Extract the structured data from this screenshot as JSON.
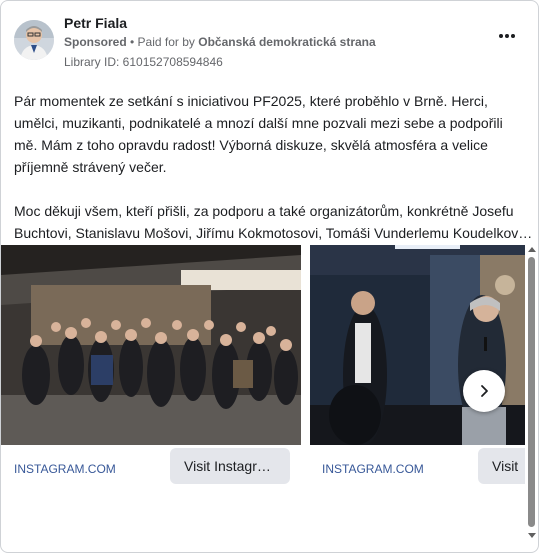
{
  "post": {
    "page_name": "Petr Fiala",
    "sponsored_label": "Sponsored",
    "separator": " • ",
    "paid_for_label": "Paid for by ",
    "advertiser": "Občanská demokratická strana",
    "library_id": "Library ID: 610152708594846",
    "more_icon": "more-horizontal-icon",
    "paragraph_1": "Pár momentek ze setkání s iniciativou PF2025, které proběhlo v Brně. Herci, umělci, muzikanti, podnikatelé a mnozí další mne pozvali mezi sebe a podpořili mě. Mám z toho opravdu radost! Výborná diskuze, skvělá atmosféra a velice příjemně strávený večer.",
    "paragraph_2_line_1": "Moc děkuji všem, kteří přišli, za podporu a také organizátorům, konkrétně Josefu",
    "paragraph_2_line_2": "Buchtovi, Stanislavu Mošovi, Jiřímu Kokmotosovi, Tomáši Vunderlemu Koudelkov…"
  },
  "carousel": {
    "cards": [
      {
        "domain": "INSTAGRAM.COM",
        "button_label": "Visit Instagr…",
        "image": "group-photo"
      },
      {
        "domain": "INSTAGRAM.COM",
        "button_label": "Visit",
        "image": "speaker-photo"
      }
    ],
    "next_icon": "chevron-right-icon"
  },
  "colors": {
    "link": "#385898",
    "button_bg": "#e4e6eb",
    "meta_text": "#65676b"
  }
}
